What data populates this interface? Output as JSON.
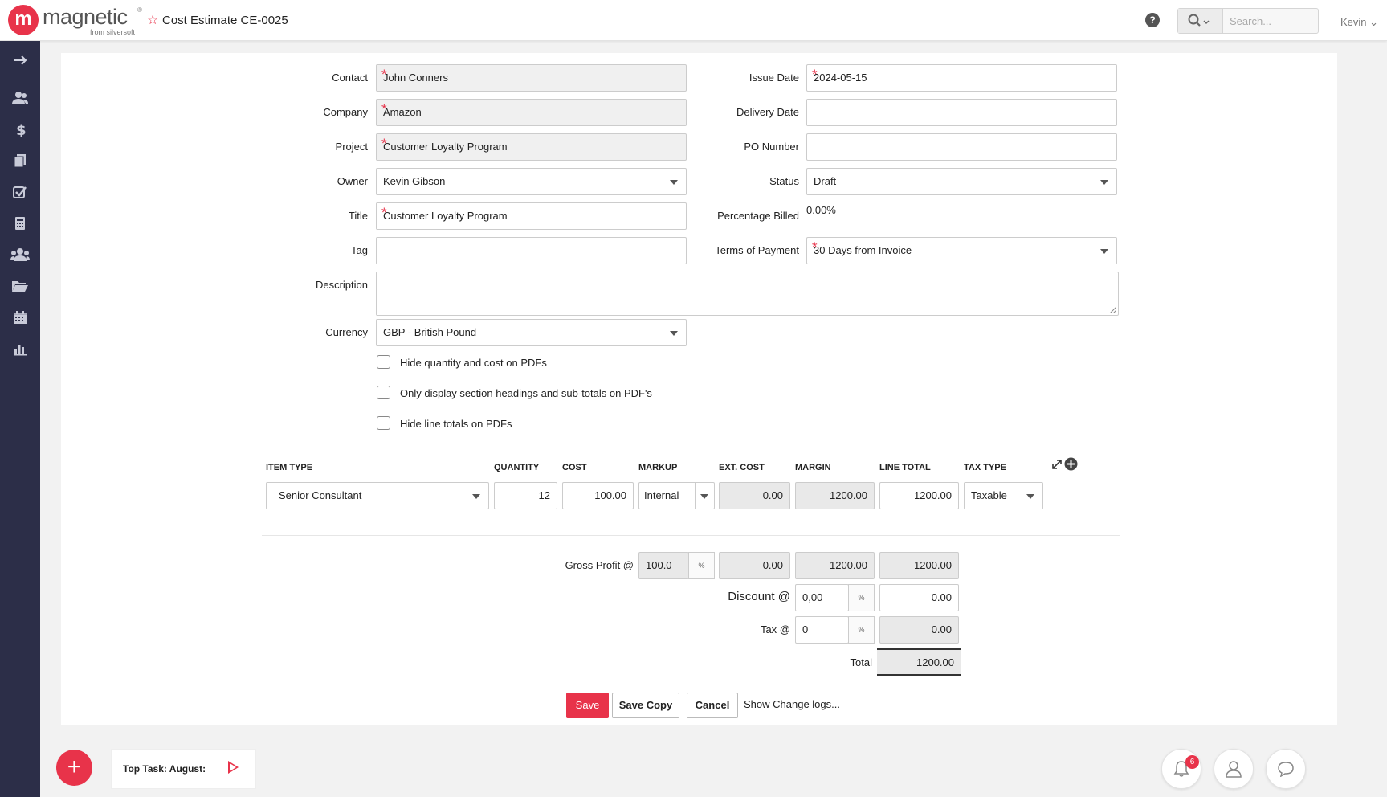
{
  "app": {
    "logo_letter": "m",
    "logo_word": "magnetic",
    "logo_sub": "from silversoft",
    "logo_reg": "®",
    "doc_title": "Cost Estimate CE-0025",
    "help_glyph": "?",
    "search_placeholder": "Search...",
    "user": "Kevin",
    "user_chevron": "⌄"
  },
  "sidebar": {
    "items": [
      {
        "icon": "arrow-right-icon"
      },
      {
        "icon": "contacts-icon"
      },
      {
        "icon": "dollar-icon"
      },
      {
        "icon": "documents-icon"
      },
      {
        "icon": "tasks-icon"
      },
      {
        "icon": "calculator-icon"
      },
      {
        "icon": "team-icon"
      },
      {
        "icon": "folder-icon"
      },
      {
        "icon": "calendar-icon"
      },
      {
        "icon": "reports-icon"
      }
    ]
  },
  "form": {
    "contact": {
      "label": "Contact",
      "value": "John Conners"
    },
    "company": {
      "label": "Company",
      "value": "Amazon"
    },
    "project": {
      "label": "Project",
      "value": "Customer Loyalty Program"
    },
    "owner": {
      "label": "Owner",
      "value": "Kevin Gibson"
    },
    "title": {
      "label": "Title",
      "value": "Customer Loyalty Program"
    },
    "tag": {
      "label": "Tag",
      "value": ""
    },
    "description": {
      "label": "Description",
      "value": ""
    },
    "currency": {
      "label": "Currency",
      "value": "GBP - British Pound"
    },
    "issue_date": {
      "label": "Issue Date",
      "value": "2024-05-15"
    },
    "delivery_date": {
      "label": "Delivery Date",
      "value": ""
    },
    "po_number": {
      "label": "PO Number",
      "value": ""
    },
    "status": {
      "label": "Status",
      "value": "Draft"
    },
    "percentage_billed": {
      "label": "Percentage Billed",
      "value": "0.00%"
    },
    "terms": {
      "label": "Terms of Payment",
      "value": "30 Days from Invoice"
    },
    "required_mark": "*"
  },
  "options": [
    {
      "label": "Hide quantity and cost on PDFs",
      "checked": false
    },
    {
      "label": "Only display section headings and sub-totals on PDF's",
      "checked": false
    },
    {
      "label": "Hide line totals on PDFs",
      "checked": false
    }
  ],
  "items": {
    "headers": [
      "ITEM TYPE",
      "QUANTITY",
      "COST",
      "MARKUP",
      "EXT. COST",
      "MARGIN",
      "LINE TOTAL",
      "TAX TYPE"
    ],
    "rows": [
      {
        "item_type": "Senior Consultant",
        "quantity": "12",
        "cost": "100.00",
        "markup": "Internal",
        "ext_cost": "0.00",
        "margin": "1200.00",
        "line_total": "1200.00",
        "tax_type": "Taxable"
      }
    ]
  },
  "totals": {
    "gross_profit_label": "Gross Profit @",
    "gross_profit_pct": "100.0",
    "gross_ext_cost": "0.00",
    "gross_margin": "1200.00",
    "gross_line_total": "1200.00",
    "discount_label": "Discount @",
    "discount_pct": "0,00",
    "discount_value": "0.00",
    "tax_label": "Tax @",
    "tax_pct": "0",
    "tax_value": "0.00",
    "total_label": "Total",
    "total_value": "1200.00",
    "pct_symbol": "%"
  },
  "buttons": {
    "save": "Save",
    "save_copy": "Save Copy",
    "cancel": "Cancel",
    "change_logs": "Show Change logs..."
  },
  "footer": {
    "fab": "+",
    "top_task": "Top Task: August:",
    "notifications_count": "6"
  },
  "colors": {
    "accent": "#e8334a",
    "sidebar": "#2c2e48"
  }
}
